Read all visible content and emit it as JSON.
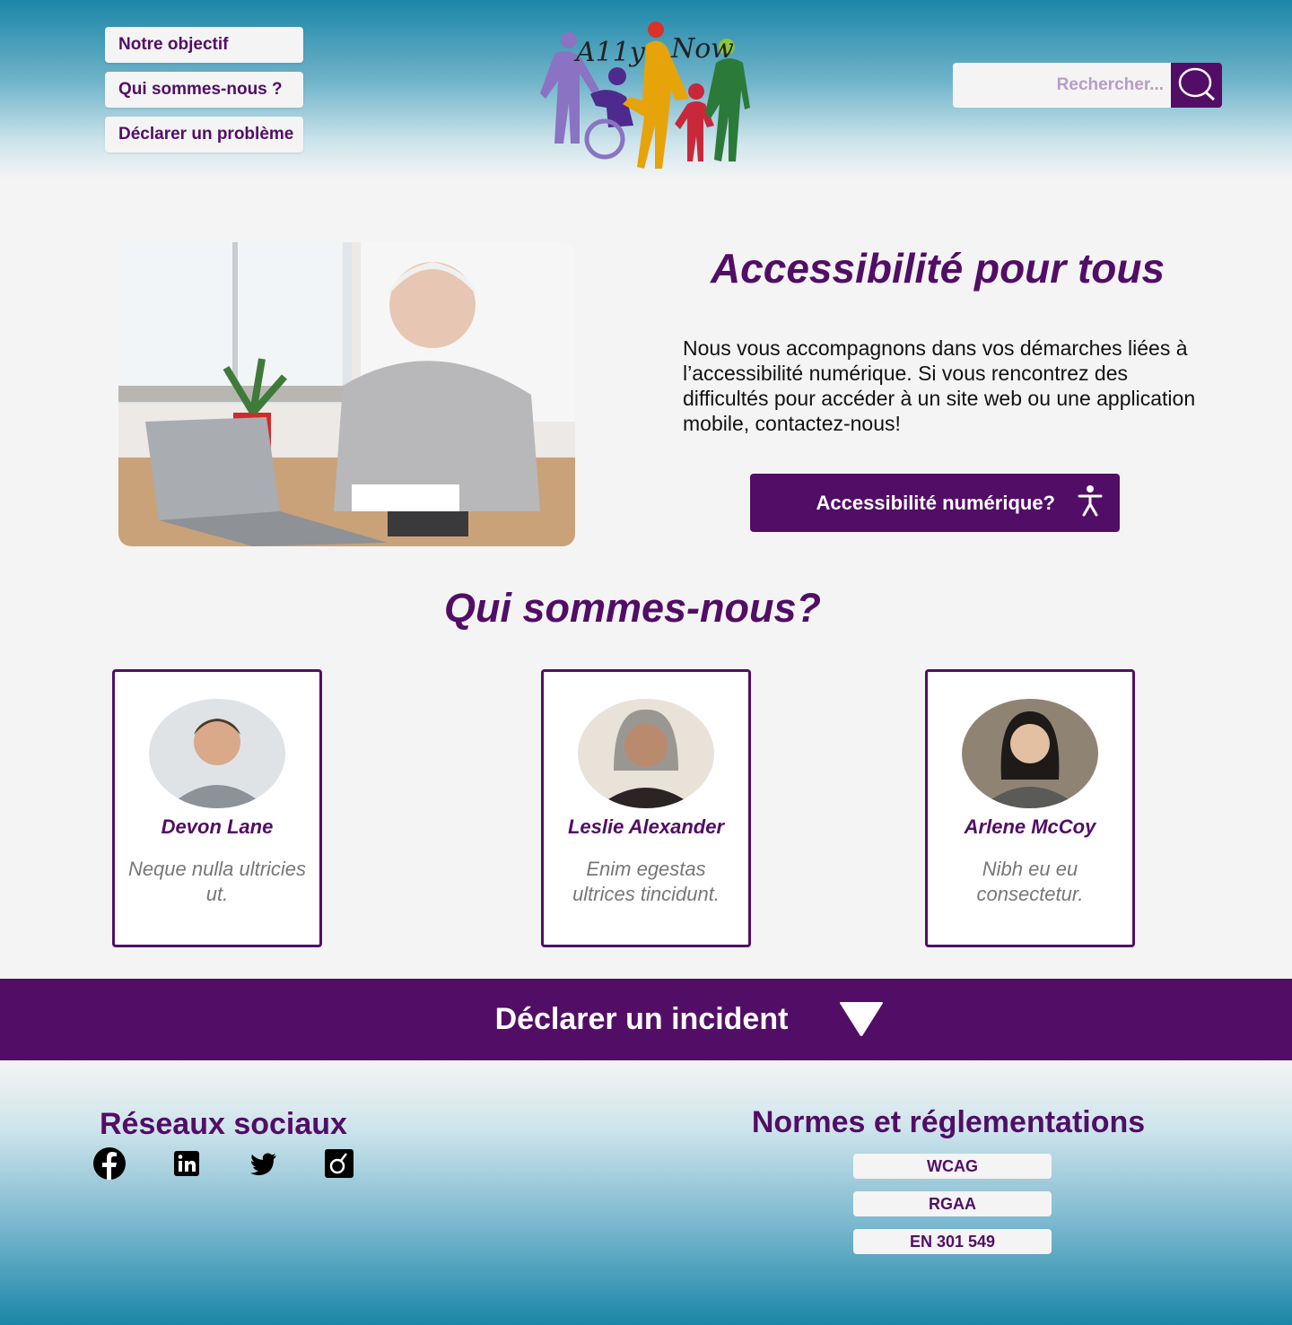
{
  "nav": {
    "items": [
      "Notre objectif",
      "Qui sommes-nous ?",
      "Déclarer un problème"
    ]
  },
  "logo": {
    "text_a11y": "A11y",
    "text_now": "Now"
  },
  "search": {
    "placeholder": "Rechercher..."
  },
  "hero": {
    "title": "Accessibilité pour tous",
    "text": "Nous vous accompagnons dans vos démarches liées à l’accessibilité numérique. Si vous rencontrez des difficultés pour accéder à un site web ou une application mobile, contactez-nous!",
    "cta_label": "Accessibilité numérique?"
  },
  "team": {
    "title": "Qui sommes-nous?",
    "members": [
      {
        "name": "Devon Lane",
        "desc": "Neque nulla ultricies ut."
      },
      {
        "name": "Leslie Alexander",
        "desc": "Enim egestas ultrices tincidunt."
      },
      {
        "name": "Arlene McCoy",
        "desc": "Nibh eu eu consectetur."
      }
    ]
  },
  "incident": {
    "label": "Déclarer un incident"
  },
  "footer": {
    "social_title": "Réseaux sociaux",
    "social_icons": [
      "facebook-icon",
      "linkedin-icon",
      "twitter-icon",
      "viadeo-icon"
    ],
    "norms_title": "Normes et réglementations",
    "norms": [
      "WCAG",
      "RGAA",
      "EN 301 549"
    ]
  },
  "colors": {
    "brand_purple": "#520d66",
    "header_teal": "#1b86a8",
    "background": "#f4f4f4"
  }
}
